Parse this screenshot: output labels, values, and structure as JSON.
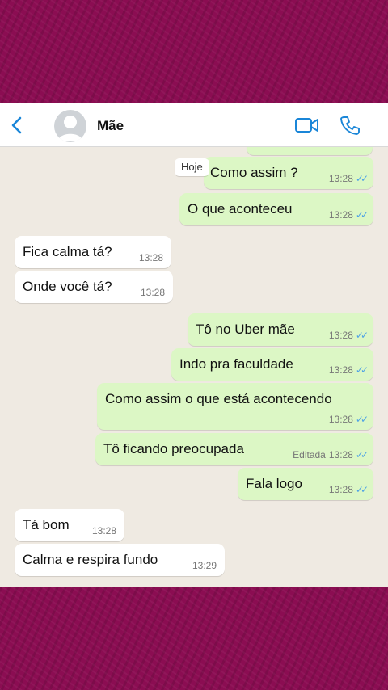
{
  "contact": {
    "name": "Mãe"
  },
  "icons": {
    "back": "chevron-left-icon",
    "avatar": "person-icon",
    "video": "video-camera-icon",
    "call": "phone-icon",
    "read": "double-check-icon"
  },
  "colors": {
    "accent": "#1a86d8",
    "outgoing_bubble": "#dcf7c5",
    "incoming_bubble": "#ffffff",
    "chat_bg": "#efeae2",
    "ticks": "#4fa3e6"
  },
  "date_separator": "Hoje",
  "messages": [
    {
      "text": "Como assim ?",
      "time": "13:28",
      "read_mark": "✓✓"
    },
    {
      "text": "O que aconteceu",
      "time": "13:28",
      "read_mark": "✓✓"
    },
    {
      "text": "Fica calma tá?",
      "time": "13:28"
    },
    {
      "text": "Onde você tá?",
      "time": "13:28"
    },
    {
      "text": "Tô no Uber mãe",
      "time": "13:28",
      "read_mark": "✓✓"
    },
    {
      "text": "Indo pra faculdade",
      "time": "13:28",
      "read_mark": "✓✓"
    },
    {
      "text": "Como assim o que está acontecendo",
      "time": "13:28",
      "read_mark": "✓✓"
    },
    {
      "text": "Tô ficando preocupada",
      "edited": "Editada",
      "time": "13:28",
      "read_mark": "✓✓"
    },
    {
      "text": "Fala logo",
      "time": "13:28",
      "read_mark": "✓✓"
    },
    {
      "text": "Tá bom",
      "time": "13:28"
    },
    {
      "text": "Calma e respira fundo",
      "time": "13:29"
    }
  ]
}
